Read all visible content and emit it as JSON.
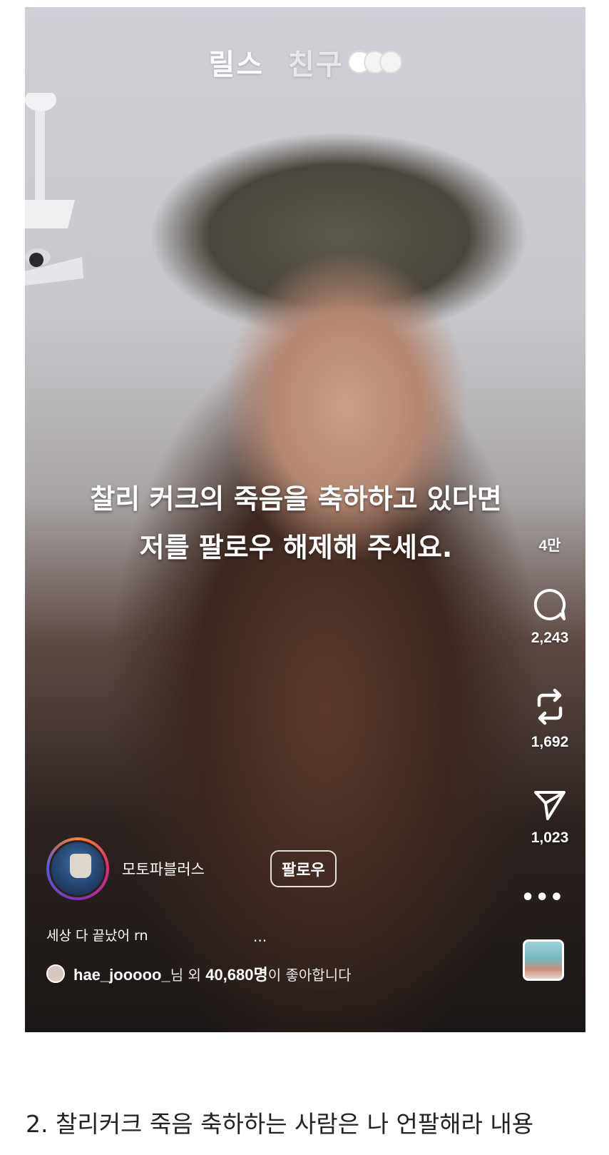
{
  "header": {
    "tab_reels": "릴스",
    "tab_friends": "친구"
  },
  "overlay_caption": {
    "line1": "찰리 커크의 죽음을 축하하고 있다면",
    "line2": "저를 팔로우 해제해 주세요."
  },
  "actions": {
    "likes_count": "4만",
    "comments_count": "2,243",
    "reposts_count": "1,692",
    "shares_count": "1,023"
  },
  "post": {
    "username": "모토파블러스",
    "follow_label": "팔로우",
    "caption": "세상 다 끝났어 rn",
    "caption_more": "...",
    "liked_by_user": "hae_jooooo_",
    "liked_by_mid": "님 외 ",
    "liked_by_count": "40,680명",
    "liked_by_suffix": "이 좋아합니다"
  },
  "menu": {
    "more": "•••"
  },
  "article": {
    "text": "2. 찰리커크 죽음 축하하는 사람은 나 언팔해라 내용"
  },
  "icons": [
    "heart-icon",
    "comment-icon",
    "repost-icon",
    "send-icon",
    "more-icon"
  ]
}
